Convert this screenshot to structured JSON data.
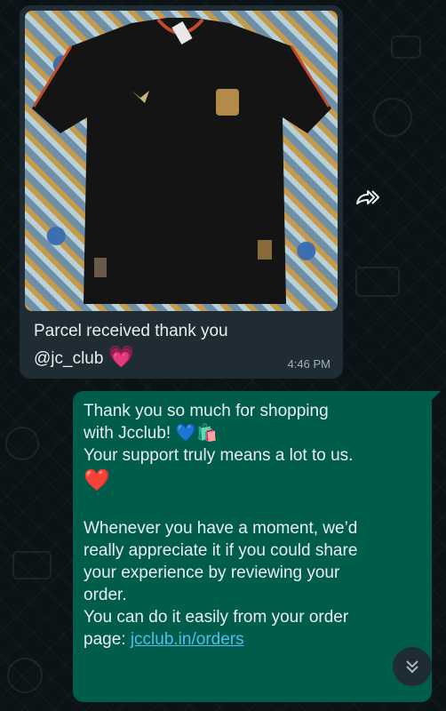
{
  "incoming": {
    "line1": "Parcel received thank you",
    "line2": "@jc_club",
    "heart": "💗",
    "time": "4:46 PM"
  },
  "outgoing": {
    "l1": "Thank you so much for shopping",
    "l2": "with Jcclub! 💙🛍️",
    "l3": "Your support truly means a lot to us.",
    "l4": "❤️",
    "l5": "Whenever you have a moment, we’d",
    "l6": "really appreciate it if you could share",
    "l7": "your experience by reviewing your",
    "l8": "order.",
    "l9": "You can do it easily from your order",
    "l10_prefix": "page: ",
    "link": "jcclub.in/orders"
  },
  "icons": {
    "forward": "forward-icon",
    "scroll": "chevron-double-down-icon"
  },
  "colors": {
    "incoming_bubble": "#1f2c33",
    "outgoing_bubble": "#005c4b",
    "link": "#53bdeb"
  }
}
